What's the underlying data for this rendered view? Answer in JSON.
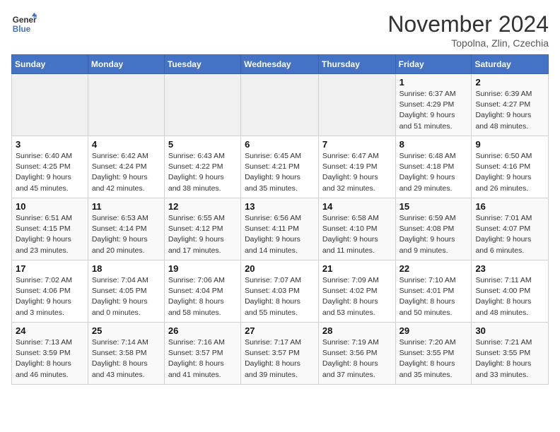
{
  "header": {
    "logo_general": "General",
    "logo_blue": "Blue",
    "month_title": "November 2024",
    "location": "Topolna, Zlin, Czechia"
  },
  "weekdays": [
    "Sunday",
    "Monday",
    "Tuesday",
    "Wednesday",
    "Thursday",
    "Friday",
    "Saturday"
  ],
  "weeks": [
    [
      {
        "day": "",
        "info": ""
      },
      {
        "day": "",
        "info": ""
      },
      {
        "day": "",
        "info": ""
      },
      {
        "day": "",
        "info": ""
      },
      {
        "day": "",
        "info": ""
      },
      {
        "day": "1",
        "info": "Sunrise: 6:37 AM\nSunset: 4:29 PM\nDaylight: 9 hours and 51 minutes."
      },
      {
        "day": "2",
        "info": "Sunrise: 6:39 AM\nSunset: 4:27 PM\nDaylight: 9 hours and 48 minutes."
      }
    ],
    [
      {
        "day": "3",
        "info": "Sunrise: 6:40 AM\nSunset: 4:25 PM\nDaylight: 9 hours and 45 minutes."
      },
      {
        "day": "4",
        "info": "Sunrise: 6:42 AM\nSunset: 4:24 PM\nDaylight: 9 hours and 42 minutes."
      },
      {
        "day": "5",
        "info": "Sunrise: 6:43 AM\nSunset: 4:22 PM\nDaylight: 9 hours and 38 minutes."
      },
      {
        "day": "6",
        "info": "Sunrise: 6:45 AM\nSunset: 4:21 PM\nDaylight: 9 hours and 35 minutes."
      },
      {
        "day": "7",
        "info": "Sunrise: 6:47 AM\nSunset: 4:19 PM\nDaylight: 9 hours and 32 minutes."
      },
      {
        "day": "8",
        "info": "Sunrise: 6:48 AM\nSunset: 4:18 PM\nDaylight: 9 hours and 29 minutes."
      },
      {
        "day": "9",
        "info": "Sunrise: 6:50 AM\nSunset: 4:16 PM\nDaylight: 9 hours and 26 minutes."
      }
    ],
    [
      {
        "day": "10",
        "info": "Sunrise: 6:51 AM\nSunset: 4:15 PM\nDaylight: 9 hours and 23 minutes."
      },
      {
        "day": "11",
        "info": "Sunrise: 6:53 AM\nSunset: 4:14 PM\nDaylight: 9 hours and 20 minutes."
      },
      {
        "day": "12",
        "info": "Sunrise: 6:55 AM\nSunset: 4:12 PM\nDaylight: 9 hours and 17 minutes."
      },
      {
        "day": "13",
        "info": "Sunrise: 6:56 AM\nSunset: 4:11 PM\nDaylight: 9 hours and 14 minutes."
      },
      {
        "day": "14",
        "info": "Sunrise: 6:58 AM\nSunset: 4:10 PM\nDaylight: 9 hours and 11 minutes."
      },
      {
        "day": "15",
        "info": "Sunrise: 6:59 AM\nSunset: 4:08 PM\nDaylight: 9 hours and 9 minutes."
      },
      {
        "day": "16",
        "info": "Sunrise: 7:01 AM\nSunset: 4:07 PM\nDaylight: 9 hours and 6 minutes."
      }
    ],
    [
      {
        "day": "17",
        "info": "Sunrise: 7:02 AM\nSunset: 4:06 PM\nDaylight: 9 hours and 3 minutes."
      },
      {
        "day": "18",
        "info": "Sunrise: 7:04 AM\nSunset: 4:05 PM\nDaylight: 9 hours and 0 minutes."
      },
      {
        "day": "19",
        "info": "Sunrise: 7:06 AM\nSunset: 4:04 PM\nDaylight: 8 hours and 58 minutes."
      },
      {
        "day": "20",
        "info": "Sunrise: 7:07 AM\nSunset: 4:03 PM\nDaylight: 8 hours and 55 minutes."
      },
      {
        "day": "21",
        "info": "Sunrise: 7:09 AM\nSunset: 4:02 PM\nDaylight: 8 hours and 53 minutes."
      },
      {
        "day": "22",
        "info": "Sunrise: 7:10 AM\nSunset: 4:01 PM\nDaylight: 8 hours and 50 minutes."
      },
      {
        "day": "23",
        "info": "Sunrise: 7:11 AM\nSunset: 4:00 PM\nDaylight: 8 hours and 48 minutes."
      }
    ],
    [
      {
        "day": "24",
        "info": "Sunrise: 7:13 AM\nSunset: 3:59 PM\nDaylight: 8 hours and 46 minutes."
      },
      {
        "day": "25",
        "info": "Sunrise: 7:14 AM\nSunset: 3:58 PM\nDaylight: 8 hours and 43 minutes."
      },
      {
        "day": "26",
        "info": "Sunrise: 7:16 AM\nSunset: 3:57 PM\nDaylight: 8 hours and 41 minutes."
      },
      {
        "day": "27",
        "info": "Sunrise: 7:17 AM\nSunset: 3:57 PM\nDaylight: 8 hours and 39 minutes."
      },
      {
        "day": "28",
        "info": "Sunrise: 7:19 AM\nSunset: 3:56 PM\nDaylight: 8 hours and 37 minutes."
      },
      {
        "day": "29",
        "info": "Sunrise: 7:20 AM\nSunset: 3:55 PM\nDaylight: 8 hours and 35 minutes."
      },
      {
        "day": "30",
        "info": "Sunrise: 7:21 AM\nSunset: 3:55 PM\nDaylight: 8 hours and 33 minutes."
      }
    ]
  ]
}
